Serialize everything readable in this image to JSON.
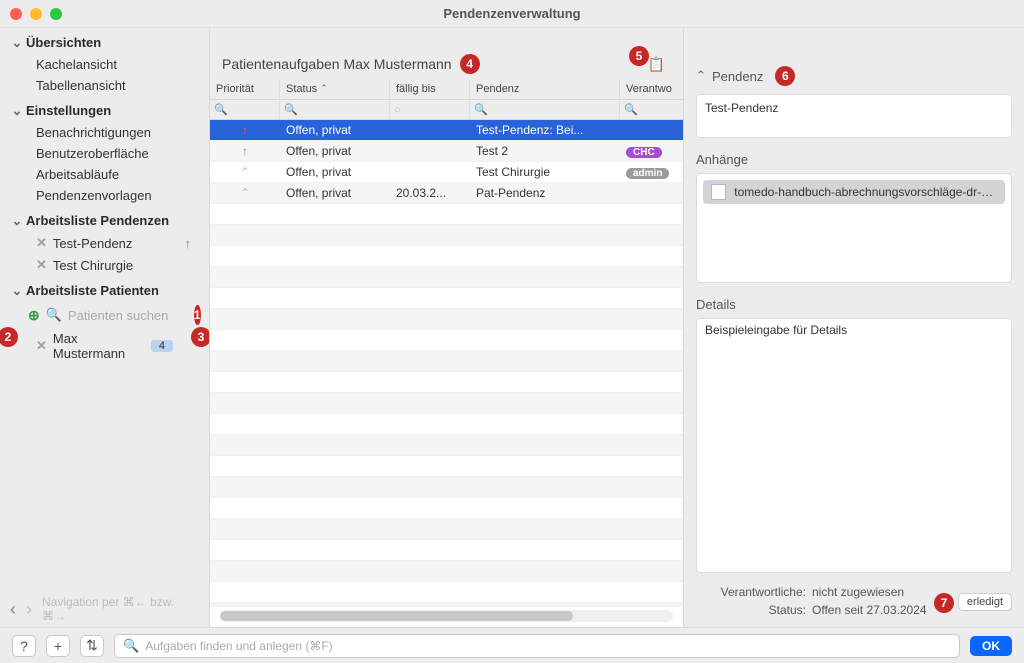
{
  "window": {
    "title": "Pendenzenverwaltung"
  },
  "sidebar": {
    "groups": [
      {
        "title": "Übersichten",
        "items": [
          "Kachelansicht",
          "Tabellenansicht"
        ]
      },
      {
        "title": "Einstellungen",
        "items": [
          "Benachrichtigungen",
          "Benutzeroberfläche",
          "Arbeitsabläufe",
          "Pendenzenvorlagen"
        ]
      }
    ],
    "worklist_pendenzen": {
      "title": "Arbeitsliste Pendenzen",
      "items": [
        "Test-Pendenz",
        "Test Chirurgie"
      ]
    },
    "worklist_patienten": {
      "title": "Arbeitsliste Patienten",
      "search_placeholder": "Patienten suchen",
      "patient": "Max Mustermann",
      "count": "4"
    },
    "footer_hint": "Navigation per ⌘← bzw. ⌘→"
  },
  "center": {
    "heading": "Patientenaufgaben Max Mustermann",
    "columns": [
      "Priorität",
      "Status",
      "fällig bis",
      "Pendenz",
      "Verantwo"
    ],
    "rows": [
      {
        "prio": "high",
        "status": "Offen, privat",
        "due": "",
        "pendenz": "Test-Pendenz: Bei...",
        "resp": "",
        "selected": true
      },
      {
        "prio": "high",
        "status": "Offen, privat",
        "due": "",
        "pendenz": "Test 2",
        "resp": "CHC"
      },
      {
        "prio": "low",
        "status": "Offen, privat",
        "due": "",
        "pendenz": "Test Chirurgie",
        "resp": "admin"
      },
      {
        "prio": "low",
        "status": "Offen, privat",
        "due": "20.03.2...",
        "pendenz": "Pat-Pendenz",
        "resp": ""
      }
    ]
  },
  "right": {
    "pendenz_label": "Pendenz",
    "pendenz_name": "Test-Pendenz",
    "attachments_label": "Anhänge",
    "attachment": "tomedo-handbuch-abrechnungsvorschläge-dr-clev...",
    "details_label": "Details",
    "details_text": "Beispieleingabe für Details",
    "meta": {
      "resp_label": "Verantwortliche:",
      "resp_value": "nicht zugewiesen",
      "status_label": "Status:",
      "status_value": "Offen seit 27.03.2024"
    },
    "done_label": "erledigt"
  },
  "bottom": {
    "search_placeholder": "Aufgaben finden und anlegen (⌘F)",
    "ok": "OK"
  },
  "annotations": {
    "a1": "1",
    "a2": "2",
    "a3": "3",
    "a4": "4",
    "a5": "5",
    "a6": "6",
    "a7": "7"
  }
}
